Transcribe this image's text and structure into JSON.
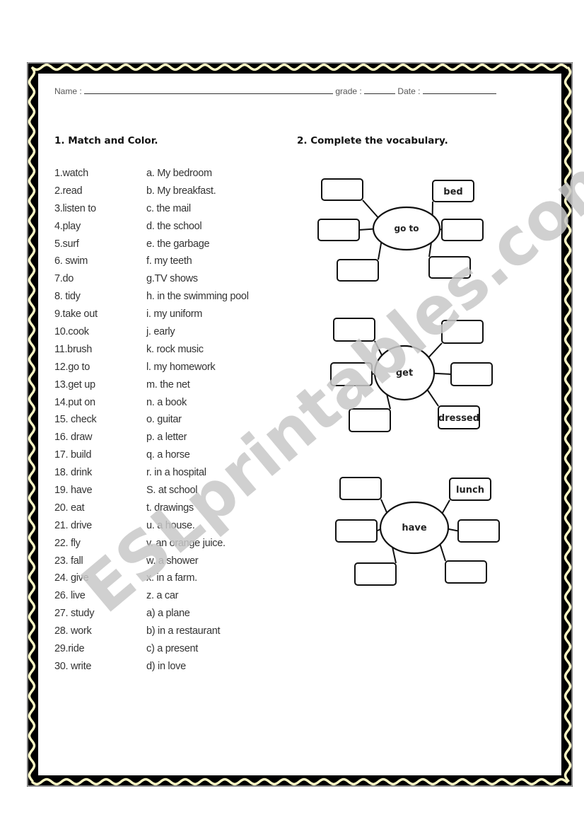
{
  "header": {
    "name_label": "Name :",
    "grade_label": "grade :",
    "date_label": "Date :"
  },
  "section1": {
    "title": "1.  Match and Color.",
    "verbs": [
      "1.watch",
      "2.read",
      "3.listen to",
      "4.play",
      "5.surf",
      "6.  swim",
      "7.do",
      "8.  tidy",
      "9.take out",
      "10.cook",
      "11.brush",
      "12.go to",
      "13.get up",
      "14.put on",
      "15.  check",
      "16.  draw",
      "17.  build",
      "18.  drink",
      "19.  have",
      "20.  eat",
      "21.  drive",
      "22.  fly",
      "23.  fall",
      "24.  give",
      "26.  live",
      "27.  study",
      "28.  work",
      "29.ride",
      "30.  write"
    ],
    "complements": [
      "a. My bedroom",
      "b. My breakfast.",
      "c.  the mail",
      "d.  the school",
      "e.  the garbage",
      "f.  my teeth",
      "g.TV shows",
      "h.  in the swimming pool",
      "i.  my uniform",
      "j. early",
      "k. rock music",
      "l.   my homework",
      "m. the net",
      "n.  a book",
      "o.  guitar",
      "p.  a letter",
      "q.  a horse",
      "r. in a hospital",
      "S.  at school",
      "t.   drawings",
      "u.  a house.",
      "v.  an orange juice.",
      "w.  a shower",
      "x.  in a farm.",
      "z.  a car",
      "a)  a plane",
      "b)  in a restaurant",
      "c)  a present",
      "d)  in love"
    ]
  },
  "section2": {
    "title": "2.  Complete the vocabulary.",
    "maps": [
      {
        "center": "go to",
        "boxes": [
          "",
          "bed",
          "",
          "",
          "",
          ""
        ]
      },
      {
        "center": "get",
        "boxes": [
          "",
          "",
          "",
          "",
          "",
          "dressed"
        ]
      },
      {
        "center": "have",
        "boxes": [
          "",
          "lunch",
          "",
          "",
          "",
          ""
        ]
      }
    ]
  },
  "watermark": {
    "text": "ESLprintables.com"
  },
  "colors": {
    "border_wave": "#fbf7c4",
    "border_dark": "#000000",
    "watermark": "#c8c8c8"
  }
}
